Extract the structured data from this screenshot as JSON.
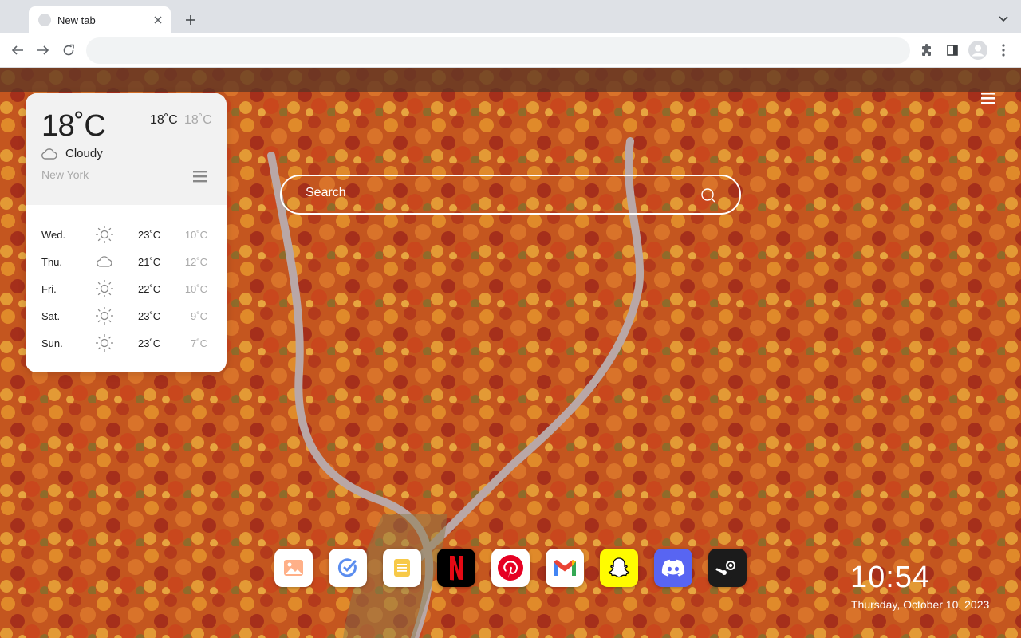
{
  "browser": {
    "tab": {
      "title": "New tab"
    },
    "omnibox": {
      "value": "",
      "placeholder": ""
    }
  },
  "weather": {
    "current_temp": "18˚C",
    "high": "18˚C",
    "low": "18˚C",
    "condition": "Cloudy",
    "condition_icon": "cloud-icon",
    "city": "New York",
    "forecast": [
      {
        "day": "Wed.",
        "icon": "sun-icon",
        "high": "23˚C",
        "low": "10˚C"
      },
      {
        "day": "Thu.",
        "icon": "cloud-icon",
        "high": "21˚C",
        "low": "12˚C"
      },
      {
        "day": "Fri.",
        "icon": "sun-icon",
        "high": "22˚C",
        "low": "10˚C"
      },
      {
        "day": "Sat.",
        "icon": "sun-icon",
        "high": "23˚C",
        "low": "9˚C"
      },
      {
        "day": "Sun.",
        "icon": "sun-icon",
        "high": "23˚C",
        "low": "7˚C"
      }
    ]
  },
  "search": {
    "placeholder": "Search"
  },
  "dock": {
    "apps": [
      {
        "name": "photos",
        "icon": "photos-app-icon",
        "color": "#ffffff"
      },
      {
        "name": "tasks",
        "icon": "tasks-app-icon",
        "color": "#ffffff"
      },
      {
        "name": "notes",
        "icon": "notes-app-icon",
        "color": "#ffffff"
      },
      {
        "name": "netflix",
        "icon": "netflix-icon",
        "color": "#000000"
      },
      {
        "name": "pinterest",
        "icon": "pinterest-icon",
        "color": "#ffffff"
      },
      {
        "name": "gmail",
        "icon": "gmail-icon",
        "color": "#ffffff"
      },
      {
        "name": "snapchat",
        "icon": "snapchat-icon",
        "color": "#fffc00"
      },
      {
        "name": "discord",
        "icon": "discord-icon",
        "color": "#5865f2"
      },
      {
        "name": "steam",
        "icon": "steam-icon",
        "color": "#1b1b1b"
      }
    ]
  },
  "clock": {
    "time": "10:54",
    "date": "Thursday, October 10, 2023"
  }
}
